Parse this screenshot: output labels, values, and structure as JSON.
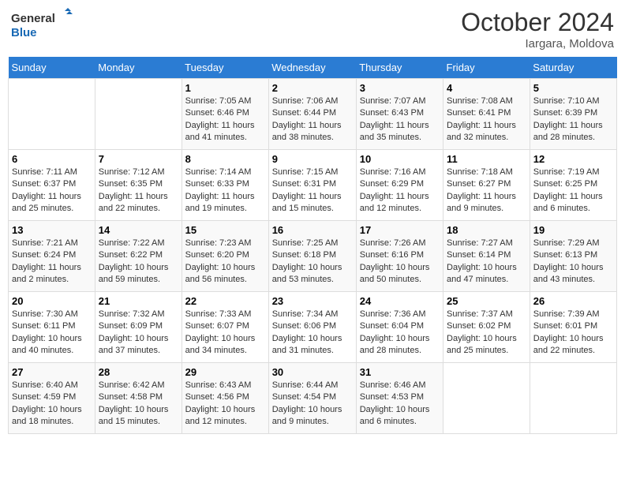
{
  "header": {
    "logo_line1": "General",
    "logo_line2": "Blue",
    "month": "October 2024",
    "location": "Iargara, Moldova"
  },
  "weekdays": [
    "Sunday",
    "Monday",
    "Tuesday",
    "Wednesday",
    "Thursday",
    "Friday",
    "Saturday"
  ],
  "weeks": [
    [
      {
        "day": "",
        "info": ""
      },
      {
        "day": "",
        "info": ""
      },
      {
        "day": "1",
        "info": "Sunrise: 7:05 AM\nSunset: 6:46 PM\nDaylight: 11 hours and 41 minutes."
      },
      {
        "day": "2",
        "info": "Sunrise: 7:06 AM\nSunset: 6:44 PM\nDaylight: 11 hours and 38 minutes."
      },
      {
        "day": "3",
        "info": "Sunrise: 7:07 AM\nSunset: 6:43 PM\nDaylight: 11 hours and 35 minutes."
      },
      {
        "day": "4",
        "info": "Sunrise: 7:08 AM\nSunset: 6:41 PM\nDaylight: 11 hours and 32 minutes."
      },
      {
        "day": "5",
        "info": "Sunrise: 7:10 AM\nSunset: 6:39 PM\nDaylight: 11 hours and 28 minutes."
      }
    ],
    [
      {
        "day": "6",
        "info": "Sunrise: 7:11 AM\nSunset: 6:37 PM\nDaylight: 11 hours and 25 minutes."
      },
      {
        "day": "7",
        "info": "Sunrise: 7:12 AM\nSunset: 6:35 PM\nDaylight: 11 hours and 22 minutes."
      },
      {
        "day": "8",
        "info": "Sunrise: 7:14 AM\nSunset: 6:33 PM\nDaylight: 11 hours and 19 minutes."
      },
      {
        "day": "9",
        "info": "Sunrise: 7:15 AM\nSunset: 6:31 PM\nDaylight: 11 hours and 15 minutes."
      },
      {
        "day": "10",
        "info": "Sunrise: 7:16 AM\nSunset: 6:29 PM\nDaylight: 11 hours and 12 minutes."
      },
      {
        "day": "11",
        "info": "Sunrise: 7:18 AM\nSunset: 6:27 PM\nDaylight: 11 hours and 9 minutes."
      },
      {
        "day": "12",
        "info": "Sunrise: 7:19 AM\nSunset: 6:25 PM\nDaylight: 11 hours and 6 minutes."
      }
    ],
    [
      {
        "day": "13",
        "info": "Sunrise: 7:21 AM\nSunset: 6:24 PM\nDaylight: 11 hours and 2 minutes."
      },
      {
        "day": "14",
        "info": "Sunrise: 7:22 AM\nSunset: 6:22 PM\nDaylight: 10 hours and 59 minutes."
      },
      {
        "day": "15",
        "info": "Sunrise: 7:23 AM\nSunset: 6:20 PM\nDaylight: 10 hours and 56 minutes."
      },
      {
        "day": "16",
        "info": "Sunrise: 7:25 AM\nSunset: 6:18 PM\nDaylight: 10 hours and 53 minutes."
      },
      {
        "day": "17",
        "info": "Sunrise: 7:26 AM\nSunset: 6:16 PM\nDaylight: 10 hours and 50 minutes."
      },
      {
        "day": "18",
        "info": "Sunrise: 7:27 AM\nSunset: 6:14 PM\nDaylight: 10 hours and 47 minutes."
      },
      {
        "day": "19",
        "info": "Sunrise: 7:29 AM\nSunset: 6:13 PM\nDaylight: 10 hours and 43 minutes."
      }
    ],
    [
      {
        "day": "20",
        "info": "Sunrise: 7:30 AM\nSunset: 6:11 PM\nDaylight: 10 hours and 40 minutes."
      },
      {
        "day": "21",
        "info": "Sunrise: 7:32 AM\nSunset: 6:09 PM\nDaylight: 10 hours and 37 minutes."
      },
      {
        "day": "22",
        "info": "Sunrise: 7:33 AM\nSunset: 6:07 PM\nDaylight: 10 hours and 34 minutes."
      },
      {
        "day": "23",
        "info": "Sunrise: 7:34 AM\nSunset: 6:06 PM\nDaylight: 10 hours and 31 minutes."
      },
      {
        "day": "24",
        "info": "Sunrise: 7:36 AM\nSunset: 6:04 PM\nDaylight: 10 hours and 28 minutes."
      },
      {
        "day": "25",
        "info": "Sunrise: 7:37 AM\nSunset: 6:02 PM\nDaylight: 10 hours and 25 minutes."
      },
      {
        "day": "26",
        "info": "Sunrise: 7:39 AM\nSunset: 6:01 PM\nDaylight: 10 hours and 22 minutes."
      }
    ],
    [
      {
        "day": "27",
        "info": "Sunrise: 6:40 AM\nSunset: 4:59 PM\nDaylight: 10 hours and 18 minutes."
      },
      {
        "day": "28",
        "info": "Sunrise: 6:42 AM\nSunset: 4:58 PM\nDaylight: 10 hours and 15 minutes."
      },
      {
        "day": "29",
        "info": "Sunrise: 6:43 AM\nSunset: 4:56 PM\nDaylight: 10 hours and 12 minutes."
      },
      {
        "day": "30",
        "info": "Sunrise: 6:44 AM\nSunset: 4:54 PM\nDaylight: 10 hours and 9 minutes."
      },
      {
        "day": "31",
        "info": "Sunrise: 6:46 AM\nSunset: 4:53 PM\nDaylight: 10 hours and 6 minutes."
      },
      {
        "day": "",
        "info": ""
      },
      {
        "day": "",
        "info": ""
      }
    ]
  ]
}
